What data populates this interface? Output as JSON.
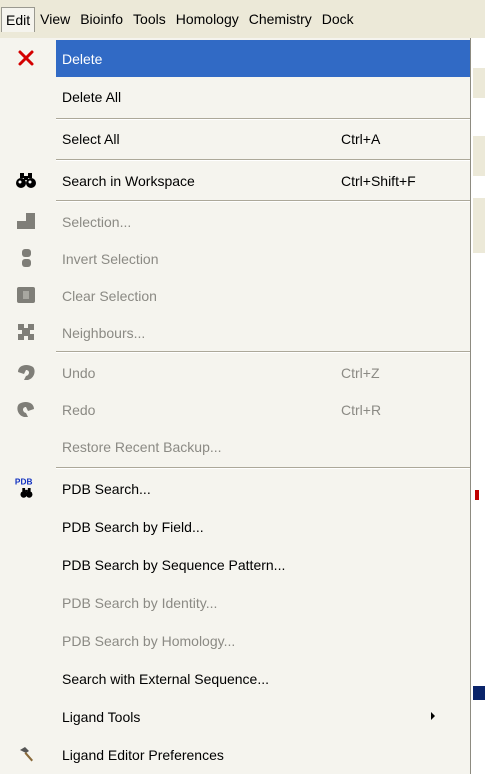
{
  "menubar": {
    "items": [
      "Edit",
      "View",
      "Bioinfo",
      "Tools",
      "Homology",
      "Chemistry",
      "Dock"
    ]
  },
  "menu": {
    "items": [
      {
        "label": "Delete",
        "shortcut": "",
        "icon": "delete-x-icon",
        "state": "highlighted"
      },
      {
        "label": "Delete All",
        "shortcut": "",
        "icon": "",
        "state": "enabled"
      },
      {
        "label": "Select All",
        "shortcut": "Ctrl+A",
        "icon": "",
        "state": "enabled"
      },
      {
        "label": "Search in Workspace",
        "shortcut": "Ctrl+Shift+F",
        "icon": "binoculars-icon",
        "state": "enabled"
      },
      {
        "label": "Selection...",
        "shortcut": "",
        "icon": "selection-icon",
        "state": "disabled"
      },
      {
        "label": "Invert Selection",
        "shortcut": "",
        "icon": "invert-selection-icon",
        "state": "disabled"
      },
      {
        "label": "Clear Selection",
        "shortcut": "",
        "icon": "clear-selection-icon",
        "state": "disabled"
      },
      {
        "label": "Neighbours...",
        "shortcut": "",
        "icon": "neighbours-icon",
        "state": "disabled"
      },
      {
        "label": "Undo",
        "shortcut": "Ctrl+Z",
        "icon": "undo-icon",
        "state": "disabled"
      },
      {
        "label": "Redo",
        "shortcut": "Ctrl+R",
        "icon": "redo-icon",
        "state": "disabled"
      },
      {
        "label": "Restore Recent Backup...",
        "shortcut": "",
        "icon": "",
        "state": "disabled"
      },
      {
        "label": "PDB Search...",
        "shortcut": "",
        "icon": "pdb-search-icon",
        "state": "enabled"
      },
      {
        "label": "PDB Search by Field...",
        "shortcut": "",
        "icon": "",
        "state": "enabled"
      },
      {
        "label": "PDB Search by Sequence Pattern...",
        "shortcut": "",
        "icon": "",
        "state": "enabled"
      },
      {
        "label": "PDB Search by Identity...",
        "shortcut": "",
        "icon": "",
        "state": "disabled"
      },
      {
        "label": "PDB Search by Homology...",
        "shortcut": "",
        "icon": "",
        "state": "disabled"
      },
      {
        "label": "Search with External Sequence...",
        "shortcut": "",
        "icon": "",
        "state": "enabled"
      },
      {
        "label": "Ligand Tools",
        "shortcut": "",
        "icon": "",
        "state": "submenu"
      },
      {
        "label": "Ligand Editor Preferences",
        "shortcut": "",
        "icon": "hammer-icon",
        "state": "enabled"
      }
    ],
    "pdb_icon_text": "PDB"
  },
  "colors": {
    "highlight": "#316ac5",
    "menu_bg": "#f5f4ee",
    "menubar_bg": "#ece9d8",
    "disabled_text": "#8b8a84",
    "delete_icon": "#d40000"
  }
}
